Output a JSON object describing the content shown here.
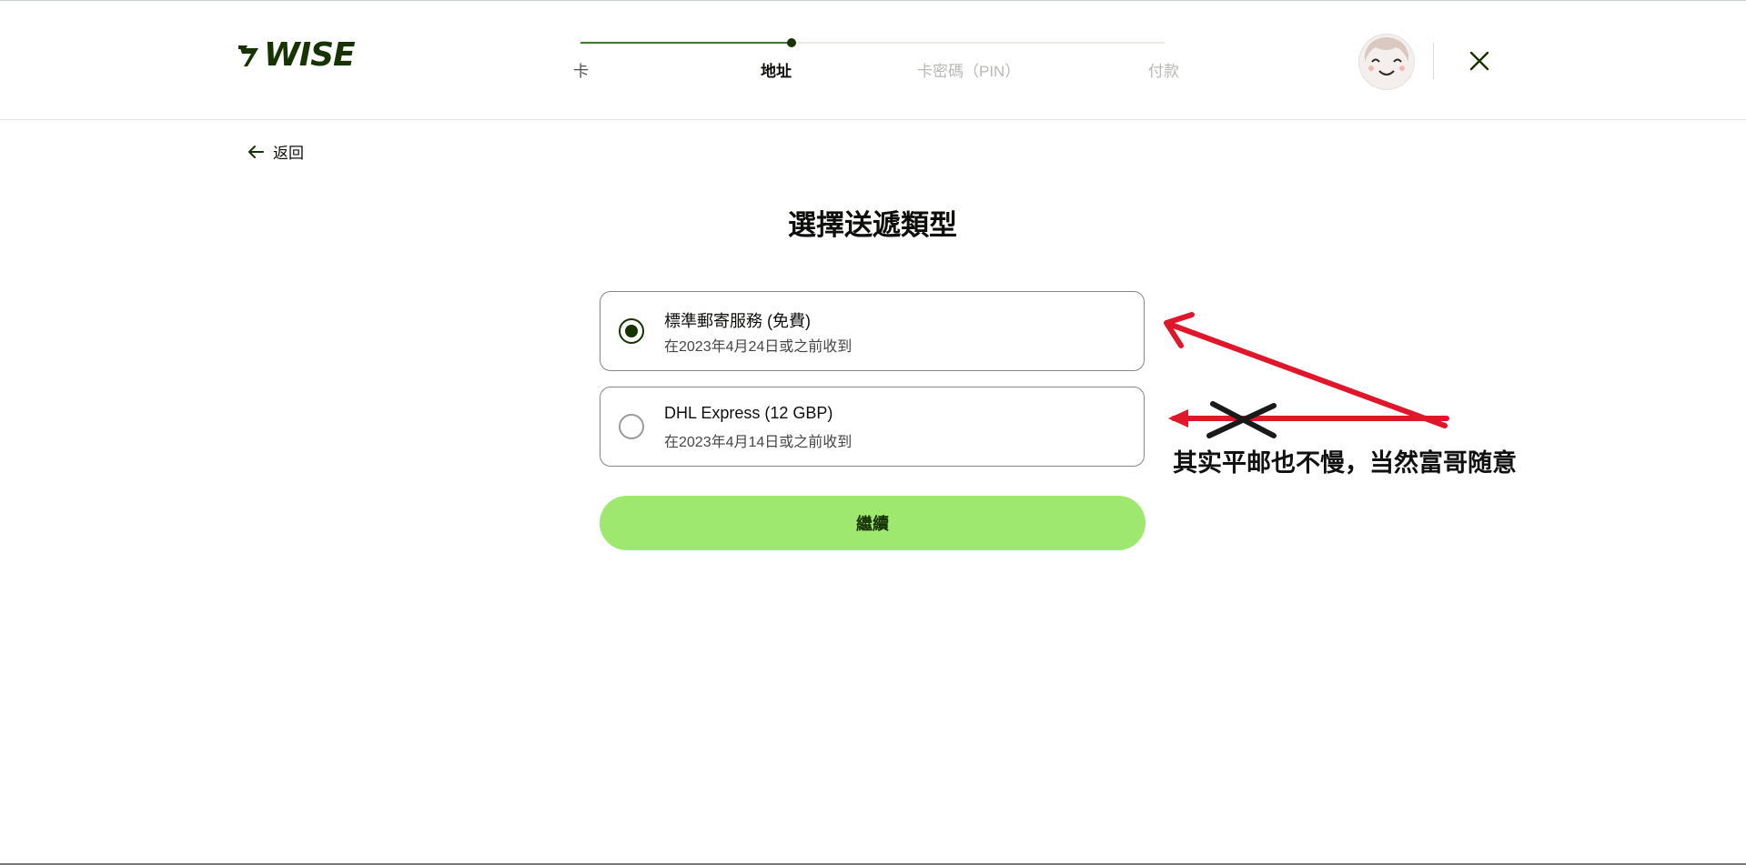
{
  "header": {
    "logo_text": "WISE",
    "stepper": {
      "steps": [
        {
          "label": "卡",
          "state": "done"
        },
        {
          "label": "地址",
          "state": "active"
        },
        {
          "label": "卡密碼（PIN）",
          "state": "pending"
        },
        {
          "label": "付款",
          "state": "pending"
        }
      ]
    },
    "close_icon": "close-icon",
    "avatar_icon": "avatar"
  },
  "nav": {
    "back_label": "返回",
    "back_icon": "arrow-left-icon"
  },
  "main": {
    "title": "選擇送遞類型",
    "options": [
      {
        "title": "標準郵寄服務 (免費)",
        "subtitle": "在2023年4月24日或之前收到",
        "selected": true
      },
      {
        "title": "DHL Express (12 GBP)",
        "subtitle": "在2023年4月14日或之前收到",
        "selected": false
      }
    ],
    "continue_label": "繼續"
  },
  "annotation": {
    "text": "其实平邮也不慢，当然富哥随意",
    "arrow_color": "#e0162b",
    "cross_color": "#1a1a1a"
  },
  "colors": {
    "brand_dark": "#163300",
    "brand_green": "#9fe870"
  }
}
